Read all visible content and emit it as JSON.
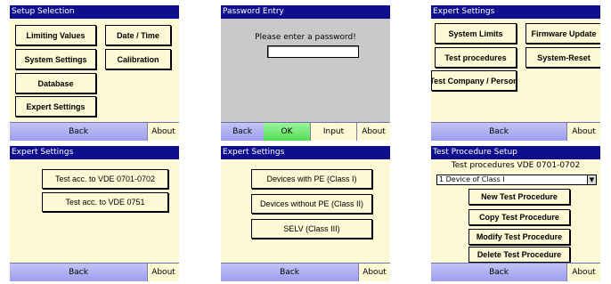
{
  "p1": {
    "title": "Setup Selection",
    "buttons": [
      "Limiting Values",
      "Date / Time",
      "System Settings",
      "Calibration",
      "Database",
      "Expert Settings"
    ],
    "back": "Back",
    "about": "About"
  },
  "p2": {
    "title": "Password Entry",
    "prompt": "Please enter a password!",
    "password_value": "",
    "back": "Back",
    "ok": "OK",
    "input": "Input",
    "about": "About"
  },
  "p3": {
    "title": "Expert Settings",
    "buttons": [
      "System Limits",
      "Firmware Update",
      "Test procedures",
      "System-Reset",
      "Test Company / Person"
    ],
    "back": "Back",
    "about": "About"
  },
  "p4": {
    "title": "Expert Settings",
    "buttons": [
      "Test acc. to VDE 0701-0702",
      "Test acc. to VDE 0751"
    ],
    "back": "Back",
    "about": "About"
  },
  "p5": {
    "title": "Expert Settings",
    "buttons": [
      "Devices with PE (Class I)",
      "Devices without PE (Class II)",
      "SELV (Class III)"
    ],
    "back": "Back",
    "about": "About"
  },
  "p6": {
    "title": "Test Procedure Setup",
    "heading": "Test procedures VDE 0701-0702",
    "selected": "1 Device of Class I",
    "buttons": [
      "New Test Procedure",
      "Copy Test Procedure",
      "Modify Test Procedure",
      "Delete Test Procedure"
    ],
    "back": "Back",
    "about": "About"
  }
}
